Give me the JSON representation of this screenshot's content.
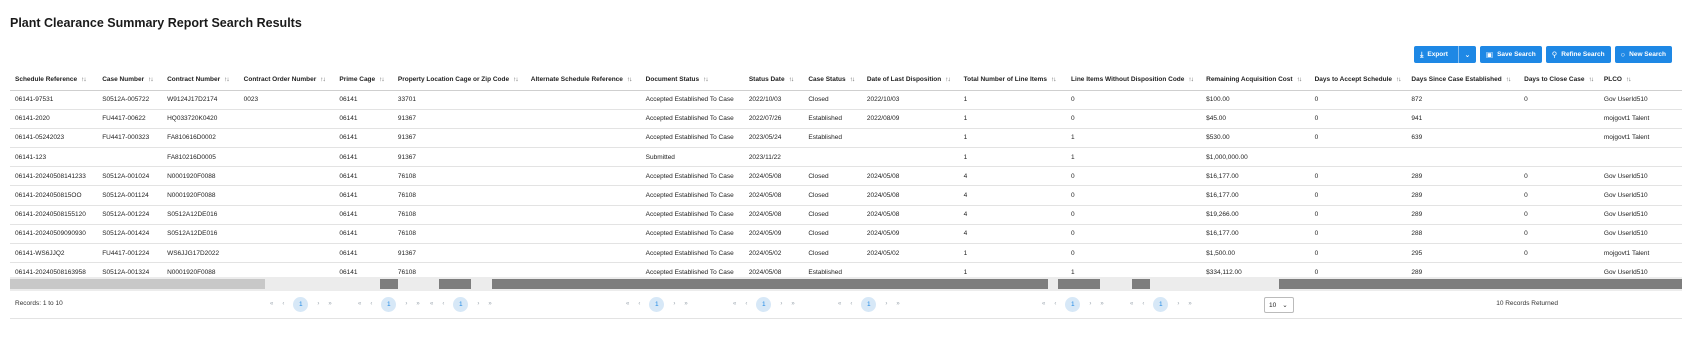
{
  "page": {
    "title": "Plant Clearance Summary Report Search Results"
  },
  "toolbar": {
    "export_label": "Export",
    "save_label": "Save Search",
    "refine_label": "Refine Search",
    "new_label": "New Search"
  },
  "table": {
    "columns": [
      "Schedule Reference",
      "Case Number",
      "Contract Number",
      "Contract Order Number",
      "Prime Cage",
      "Property Location Cage or Zip Code",
      "Alternate Schedule Reference",
      "Document Status",
      "Status Date",
      "Case Status",
      "Date of Last Disposition",
      "Total Number of Line Items",
      "Line Items Without Disposition Code",
      "Remaining Acquisition Cost",
      "Days to Accept Schedule",
      "Days Since Case Established",
      "Days to Close Case",
      "PLCO"
    ],
    "rows": [
      [
        "06141-97531",
        "S0512A-005722",
        "W9124J17D2174",
        "0023",
        "06141",
        "33701",
        "",
        "Accepted Established To Case",
        "2022/10/03",
        "Closed",
        "2022/10/03",
        "1",
        "0",
        "$100.00",
        "0",
        "872",
        "0",
        "Gov UserId510"
      ],
      [
        "06141-2020",
        "FU4417-00622",
        "HQ033720K0420",
        "",
        "06141",
        "91367",
        "",
        "Accepted Established To Case",
        "2022/07/26",
        "Established",
        "2022/08/09",
        "1",
        "0",
        "$45.00",
        "0",
        "941",
        "",
        "mojgovt1 Talent"
      ],
      [
        "06141-05242023",
        "FU4417-000323",
        "FA810616D0002",
        "",
        "06141",
        "91367",
        "",
        "Accepted Established To Case",
        "2023/05/24",
        "Established",
        "",
        "1",
        "1",
        "$530.00",
        "0",
        "639",
        "",
        "mojgovt1 Talent"
      ],
      [
        "06141-123",
        "",
        "FA810216D0005",
        "",
        "06141",
        "91367",
        "",
        "Submitted",
        "2023/11/22",
        "",
        "",
        "1",
        "1",
        "$1,000,000.00",
        "",
        "",
        "",
        ""
      ],
      [
        "06141-20240508141233",
        "S0512A-001024",
        "N0001920F0088",
        "",
        "06141",
        "76108",
        "",
        "Accepted Established To Case",
        "2024/05/08",
        "Closed",
        "2024/05/08",
        "4",
        "0",
        "$16,177.00",
        "0",
        "289",
        "0",
        "Gov UserId510"
      ],
      [
        "06141-2024050815OO",
        "S0512A-001124",
        "N0001920F0088",
        "",
        "06141",
        "76108",
        "",
        "Accepted Established To Case",
        "2024/05/08",
        "Closed",
        "2024/05/08",
        "4",
        "0",
        "$16,177.00",
        "0",
        "289",
        "0",
        "Gov UserId510"
      ],
      [
        "06141-20240508155120",
        "S0512A-001224",
        "S0512A12DE016",
        "",
        "06141",
        "76108",
        "",
        "Accepted Established To Case",
        "2024/05/08",
        "Closed",
        "2024/05/08",
        "4",
        "0",
        "$19,266.00",
        "0",
        "289",
        "0",
        "Gov UserId510"
      ],
      [
        "06141-20240509090930",
        "S0512A-001424",
        "S0512A12DE016",
        "",
        "06141",
        "76108",
        "",
        "Accepted Established To Case",
        "2024/05/09",
        "Closed",
        "2024/05/09",
        "4",
        "0",
        "$16,177.00",
        "0",
        "288",
        "0",
        "Gov UserId510"
      ],
      [
        "06141-WS6JJQ2",
        "FU4417-001224",
        "WS6JJG17D2022",
        "",
        "06141",
        "91367",
        "",
        "Accepted Established To Case",
        "2024/05/02",
        "Closed",
        "2024/05/02",
        "1",
        "0",
        "$1,500.00",
        "0",
        "295",
        "0",
        "mojgovt1 Talent"
      ],
      [
        "06141-20240508163958",
        "S0512A-001324",
        "N0001920F0088",
        "",
        "06141",
        "76108",
        "",
        "Accepted Established To Case",
        "2024/05/08",
        "Established",
        "",
        "1",
        "1",
        "$334,112.00",
        "0",
        "289",
        "",
        "Gov UserId510"
      ]
    ]
  },
  "footer": {
    "records_left": "Records: 1 to 10",
    "records_right": "10 Records Returned",
    "page_size": "10",
    "current_page": "1",
    "first_symbol": "«",
    "prev_symbol": "‹",
    "next_symbol": "›",
    "last_symbol": "»"
  },
  "icons": {
    "export": "download-icon",
    "save": "save-icon",
    "refine": "filter-icon",
    "new": "search-icon",
    "sort": "sort-icon"
  },
  "colors": {
    "primary": "#1e88e5",
    "scroll_thumb": "#7d7d7d"
  }
}
